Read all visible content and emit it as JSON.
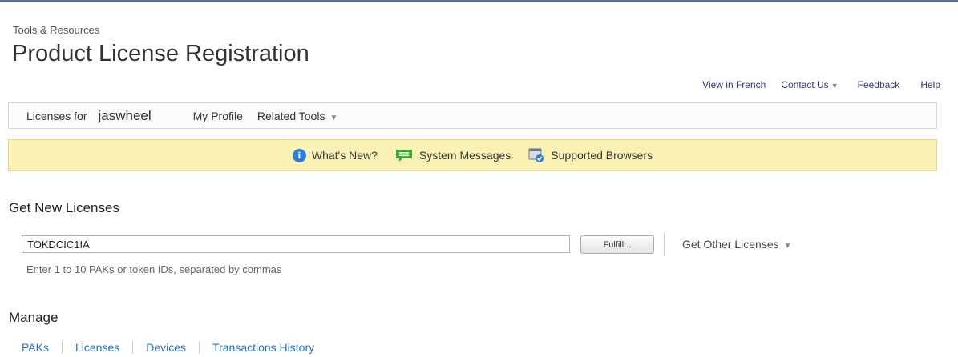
{
  "header": {
    "breadcrumb": "Tools & Resources",
    "title": "Product License Registration"
  },
  "utility_links": {
    "view_in_french": "View in French",
    "contact_us": "Contact Us",
    "feedback": "Feedback",
    "help": "Help"
  },
  "navbar": {
    "licenses_for": "Licenses for",
    "username": "jaswheel",
    "my_profile": "My Profile",
    "related_tools": "Related Tools"
  },
  "banner": {
    "whats_new": "What's New?",
    "system_messages": "System Messages",
    "supported_browsers": "Supported Browsers"
  },
  "get_new_licenses": {
    "heading": "Get New Licenses",
    "input_value": "TOKDCIC1IA",
    "fulfill_button": "Fulfill...",
    "get_other_licenses": "Get Other Licenses",
    "hint": "Enter 1 to 10 PAKs or token IDs, separated by commas"
  },
  "manage": {
    "heading": "Manage",
    "links": [
      "PAKs",
      "Licenses",
      "Devices",
      "Transactions History"
    ]
  },
  "colors": {
    "link_blue": "#2a73b6",
    "utility_link": "#2d3a7c",
    "banner_bg": "#faf2b4",
    "info_icon": "#2e7fd6",
    "message_icon": "#3aa832"
  }
}
